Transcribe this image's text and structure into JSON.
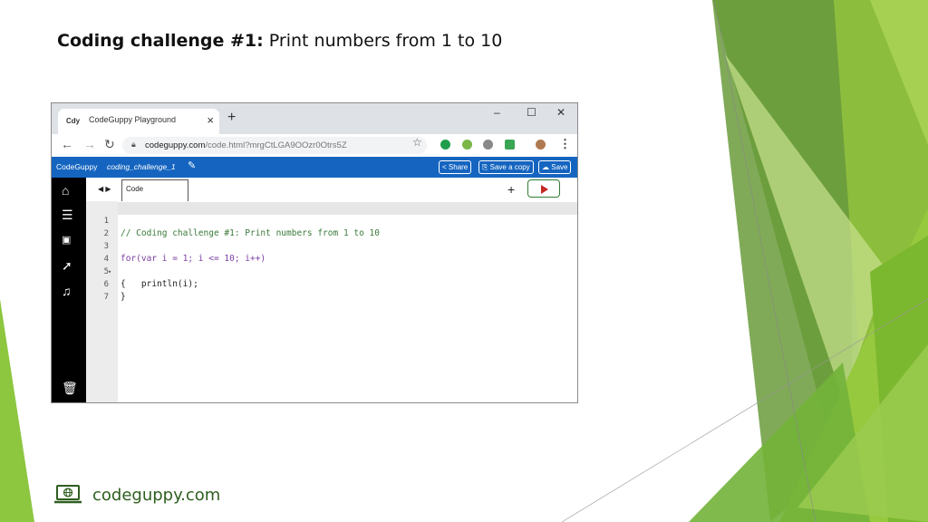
{
  "slide": {
    "title_bold": "Coding challenge #1:",
    "title_rest": " Print numbers from 1 to 10",
    "footer": "codeguppy.com"
  },
  "browser": {
    "tab_title": "CodeGuppy Playground",
    "favicon_text": "Cdy",
    "url_domain": "codeguppy.com",
    "url_path": "/code.html?mrgCtLGA9OOzr0Otrs5Z",
    "colors": {
      "tabstrip": "#dee1e6",
      "urlbar": "#f1f3f4"
    }
  },
  "app": {
    "brand": "CodeGuppy",
    "project": "coding_challenge_1",
    "buttons": {
      "share": "Share",
      "save_copy": "Save a copy",
      "save": "Save"
    },
    "file_tab": "Code",
    "colors": {
      "appbar": "#1565c0",
      "sidebar": "#000000",
      "run_border": "#2e7d32",
      "run_icon": "#c62828"
    },
    "sidebar_icons": [
      "home-icon",
      "menu-icon",
      "image-icon",
      "rocket-icon",
      "music-icon",
      "trash-icon"
    ]
  },
  "editor": {
    "lines": [
      {
        "n": "1",
        "code": "// Coding challenge #1: Print numbers from 1 to 10"
      },
      {
        "n": "2",
        "code": ""
      },
      {
        "n": "3",
        "code": "for(var i = 1; i <= 10; i++)"
      },
      {
        "n": "4",
        "code": "{"
      },
      {
        "n": "5",
        "code": "    println(i);"
      },
      {
        "n": "6",
        "code": "}"
      },
      {
        "n": "7",
        "code": ""
      }
    ]
  }
}
